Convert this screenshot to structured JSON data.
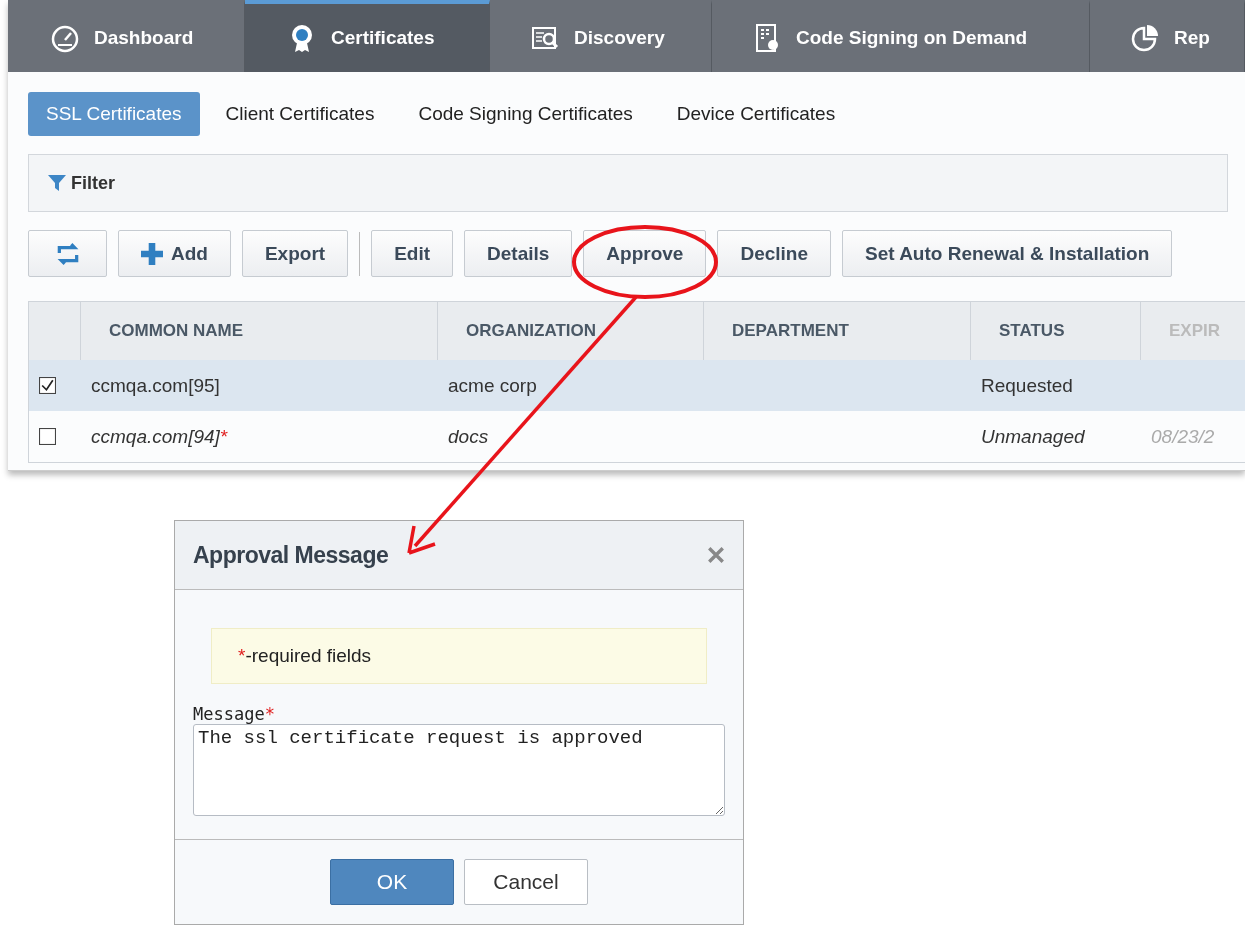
{
  "nav_tabs": [
    {
      "label": "Dashboard",
      "kind": "gauge",
      "selected": false
    },
    {
      "label": "Certificates",
      "kind": "rosette",
      "selected": true
    },
    {
      "label": "Discovery",
      "kind": "docsearch",
      "selected": false
    },
    {
      "label": "Code Signing on Demand",
      "kind": "docgrid",
      "selected": false
    },
    {
      "label": "Rep",
      "kind": "pie",
      "selected": false
    }
  ],
  "sub_tabs": [
    {
      "label": "SSL Certificates",
      "selected": true
    },
    {
      "label": "Client Certificates",
      "selected": false
    },
    {
      "label": "Code Signing Certificates",
      "selected": false
    },
    {
      "label": "Device Certificates",
      "selected": false
    }
  ],
  "filter": {
    "label": "Filter"
  },
  "toolbar_groups": [
    [
      {
        "kind": "refresh"
      },
      {
        "kind": "add",
        "label": "Add"
      },
      {
        "kind": "plain",
        "label": "Export"
      }
    ],
    [
      {
        "kind": "plain",
        "label": "Edit"
      },
      {
        "kind": "plain",
        "label": "Details"
      },
      {
        "kind": "plain",
        "label": "Approve"
      },
      {
        "kind": "plain",
        "label": "Decline"
      },
      {
        "kind": "plain",
        "label": "Set Auto Renewal & Installation"
      }
    ]
  ],
  "table": {
    "columns": [
      "COMMON NAME",
      "ORGANIZATION",
      "DEPARTMENT",
      "STATUS",
      "EXPIR"
    ],
    "rows": [
      {
        "selected": true,
        "checked": true,
        "italic": false,
        "common_name": "ccmqa.com[95]",
        "marker": "",
        "organization": "acme corp",
        "department": "",
        "status": "Requested",
        "expiry": ""
      },
      {
        "selected": false,
        "checked": false,
        "italic": true,
        "common_name": "ccmqa.com[94]",
        "marker": "*",
        "organization": "docs",
        "department": "",
        "status": "Unmanaged",
        "expiry": "08/23/2"
      }
    ]
  },
  "dialog": {
    "title": "Approval Message",
    "notice": {
      "marker": "*",
      "text": "-required fields"
    },
    "field": {
      "label": "Message",
      "marker": "*",
      "value": "The ssl certificate request is approved"
    },
    "buttons": [
      {
        "label": "OK",
        "kind": "primary"
      },
      {
        "label": "Cancel",
        "kind": "secondary"
      }
    ]
  }
}
